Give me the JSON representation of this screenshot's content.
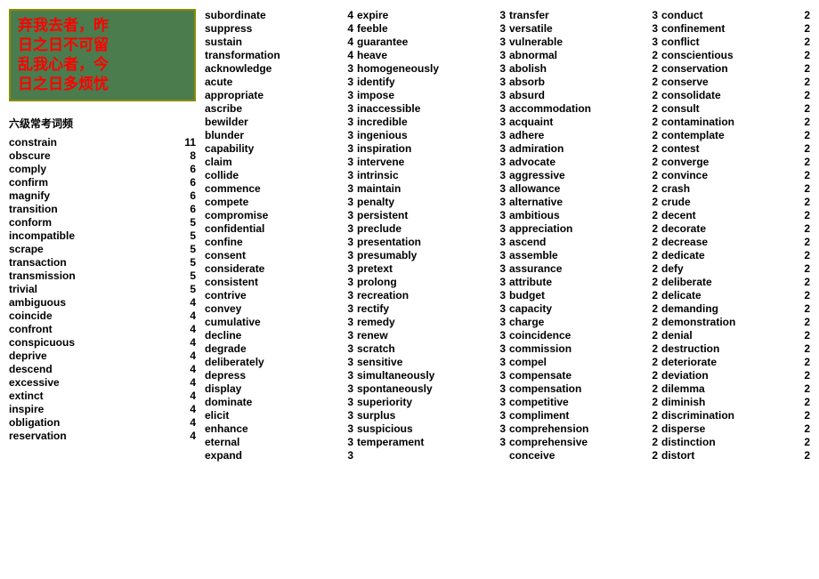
{
  "logo": {
    "lines": [
      "弃我去者，昨",
      "日之日不可留",
      "乱我心者，今",
      "日之日多烦忧"
    ]
  },
  "sectionTitle": "六级常考词频",
  "leftWords": [
    {
      "word": "constrain",
      "count": "11"
    },
    {
      "word": "obscure",
      "count": "8"
    },
    {
      "word": "comply",
      "count": "6"
    },
    {
      "word": "confirm",
      "count": "6"
    },
    {
      "word": "magnify",
      "count": "6"
    },
    {
      "word": "transition",
      "count": "6"
    },
    {
      "word": "conform",
      "count": "5"
    },
    {
      "word": "incompatible",
      "count": "5"
    },
    {
      "word": "scrape",
      "count": "5"
    },
    {
      "word": "transaction",
      "count": "5"
    },
    {
      "word": "transmission",
      "count": "5"
    },
    {
      "word": "trivial",
      "count": "5"
    },
    {
      "word": "ambiguous",
      "count": "4"
    },
    {
      "word": "coincide",
      "count": "4"
    },
    {
      "word": "confront",
      "count": "4"
    },
    {
      "word": "conspicuous",
      "count": "4"
    },
    {
      "word": "deprive",
      "count": "4"
    },
    {
      "word": "descend",
      "count": "4"
    },
    {
      "word": "excessive",
      "count": "4"
    },
    {
      "word": "extinct",
      "count": "4"
    },
    {
      "word": "inspire",
      "count": "4"
    },
    {
      "word": "obligation",
      "count": "4"
    },
    {
      "word": "reservation",
      "count": "4"
    }
  ],
  "col1": [
    {
      "word": "subordinate",
      "count": "4"
    },
    {
      "word": "suppress",
      "count": "4"
    },
    {
      "word": "sustain",
      "count": "4"
    },
    {
      "word": "transformation",
      "count": "4"
    },
    {
      "word": "acknowledge",
      "count": "3"
    },
    {
      "word": "acute",
      "count": "3"
    },
    {
      "word": "appropriate",
      "count": "3"
    },
    {
      "word": "ascribe",
      "count": "3"
    },
    {
      "word": "bewilder",
      "count": "3"
    },
    {
      "word": "blunder",
      "count": "3"
    },
    {
      "word": "capability",
      "count": "3"
    },
    {
      "word": "claim",
      "count": "3"
    },
    {
      "word": "collide",
      "count": "3"
    },
    {
      "word": "commence",
      "count": "3"
    },
    {
      "word": "compete",
      "count": "3"
    },
    {
      "word": "compromise",
      "count": "3"
    },
    {
      "word": "confidential",
      "count": "3"
    },
    {
      "word": "confine",
      "count": "3"
    },
    {
      "word": "consent",
      "count": "3"
    },
    {
      "word": "considerate",
      "count": "3"
    },
    {
      "word": "consistent",
      "count": "3"
    },
    {
      "word": "contrive",
      "count": "3"
    },
    {
      "word": "convey",
      "count": "3"
    },
    {
      "word": "cumulative",
      "count": "3"
    },
    {
      "word": "decline",
      "count": "3"
    },
    {
      "word": "degrade",
      "count": "3"
    },
    {
      "word": "deliberately",
      "count": "3"
    },
    {
      "word": "depress",
      "count": "3"
    },
    {
      "word": "display",
      "count": "3"
    },
    {
      "word": "dominate",
      "count": "3"
    },
    {
      "word": "elicit",
      "count": "3"
    },
    {
      "word": "enhance",
      "count": "3"
    },
    {
      "word": "eternal",
      "count": "3"
    },
    {
      "word": "expand",
      "count": "3"
    }
  ],
  "col2": [
    {
      "word": "expire",
      "count": "3"
    },
    {
      "word": "feeble",
      "count": "3"
    },
    {
      "word": "guarantee",
      "count": "3"
    },
    {
      "word": "heave",
      "count": "3"
    },
    {
      "word": "homogeneously",
      "count": "3"
    },
    {
      "word": "identify",
      "count": "3"
    },
    {
      "word": "impose",
      "count": "3"
    },
    {
      "word": "inaccessible",
      "count": "3"
    },
    {
      "word": "incredible",
      "count": "3"
    },
    {
      "word": "ingenious",
      "count": "3"
    },
    {
      "word": "inspiration",
      "count": "3"
    },
    {
      "word": "intervene",
      "count": "3"
    },
    {
      "word": "intrinsic",
      "count": "3"
    },
    {
      "word": "maintain",
      "count": "3"
    },
    {
      "word": "penalty",
      "count": "3"
    },
    {
      "word": "persistent",
      "count": "3"
    },
    {
      "word": "preclude",
      "count": "3"
    },
    {
      "word": "presentation",
      "count": "3"
    },
    {
      "word": "presumably",
      "count": "3"
    },
    {
      "word": "pretext",
      "count": "3"
    },
    {
      "word": "prolong",
      "count": "3"
    },
    {
      "word": "recreation",
      "count": "3"
    },
    {
      "word": "rectify",
      "count": "3"
    },
    {
      "word": "remedy",
      "count": "3"
    },
    {
      "word": "renew",
      "count": "3"
    },
    {
      "word": "scratch",
      "count": "3"
    },
    {
      "word": "sensitive",
      "count": "3"
    },
    {
      "word": "simultaneously",
      "count": "3"
    },
    {
      "word": "spontaneously",
      "count": "3"
    },
    {
      "word": "superiority",
      "count": "3"
    },
    {
      "word": "surplus",
      "count": "3"
    },
    {
      "word": "suspicious",
      "count": "3"
    },
    {
      "word": "temperament",
      "count": "3"
    }
  ],
  "col3": [
    {
      "word": "transfer",
      "count": "3"
    },
    {
      "word": "versatile",
      "count": "3"
    },
    {
      "word": "vulnerable",
      "count": "3"
    },
    {
      "word": "abnormal",
      "count": "2"
    },
    {
      "word": "abolish",
      "count": "2"
    },
    {
      "word": "absorb",
      "count": "2"
    },
    {
      "word": "absurd",
      "count": "2"
    },
    {
      "word": "accommodation",
      "count": "2"
    },
    {
      "word": "acquaint",
      "count": "2"
    },
    {
      "word": "adhere",
      "count": "2"
    },
    {
      "word": "admiration",
      "count": "2"
    },
    {
      "word": "advocate",
      "count": "2"
    },
    {
      "word": "aggressive",
      "count": "2"
    },
    {
      "word": "allowance",
      "count": "2"
    },
    {
      "word": "alternative",
      "count": "2"
    },
    {
      "word": "ambitious",
      "count": "2"
    },
    {
      "word": "appreciation",
      "count": "2"
    },
    {
      "word": "ascend",
      "count": "2"
    },
    {
      "word": "assemble",
      "count": "2"
    },
    {
      "word": "assurance",
      "count": "2"
    },
    {
      "word": "attribute",
      "count": "2"
    },
    {
      "word": "budget",
      "count": "2"
    },
    {
      "word": "capacity",
      "count": "2"
    },
    {
      "word": "charge",
      "count": "2"
    },
    {
      "word": "coincidence",
      "count": "2"
    },
    {
      "word": "commission",
      "count": "2"
    },
    {
      "word": "compel",
      "count": "2"
    },
    {
      "word": "compensate",
      "count": "2"
    },
    {
      "word": "compensation",
      "count": "2"
    },
    {
      "word": "competitive",
      "count": "2"
    },
    {
      "word": "compliment",
      "count": "2"
    },
    {
      "word": "comprehension",
      "count": "2"
    },
    {
      "word": "comprehensive",
      "count": "2"
    },
    {
      "word": "conceive",
      "count": "2"
    }
  ],
  "col4": [
    {
      "word": "conduct",
      "count": "2"
    },
    {
      "word": "confinement",
      "count": "2"
    },
    {
      "word": "conflict",
      "count": "2"
    },
    {
      "word": "conscientious",
      "count": "2"
    },
    {
      "word": "conservation",
      "count": "2"
    },
    {
      "word": "conserve",
      "count": "2"
    },
    {
      "word": "consolidate",
      "count": "2"
    },
    {
      "word": "consult",
      "count": "2"
    },
    {
      "word": "contamination",
      "count": "2"
    },
    {
      "word": "contemplate",
      "count": "2"
    },
    {
      "word": "contest",
      "count": "2"
    },
    {
      "word": "converge",
      "count": "2"
    },
    {
      "word": "convince",
      "count": "2"
    },
    {
      "word": "crash",
      "count": "2"
    },
    {
      "word": "crude",
      "count": "2"
    },
    {
      "word": "decent",
      "count": "2"
    },
    {
      "word": "decorate",
      "count": "2"
    },
    {
      "word": "decrease",
      "count": "2"
    },
    {
      "word": "dedicate",
      "count": "2"
    },
    {
      "word": "defy",
      "count": "2"
    },
    {
      "word": "deliberate",
      "count": "2"
    },
    {
      "word": "delicate",
      "count": "2"
    },
    {
      "word": "demanding",
      "count": "2"
    },
    {
      "word": "demonstration",
      "count": "2"
    },
    {
      "word": "denial",
      "count": "2"
    },
    {
      "word": "destruction",
      "count": "2"
    },
    {
      "word": "deteriorate",
      "count": "2"
    },
    {
      "word": "deviation",
      "count": "2"
    },
    {
      "word": "dilemma",
      "count": "2"
    },
    {
      "word": "diminish",
      "count": "2"
    },
    {
      "word": "discrimination",
      "count": "2"
    },
    {
      "word": "disperse",
      "count": "2"
    },
    {
      "word": "distinction",
      "count": "2"
    },
    {
      "word": "distort",
      "count": "2"
    }
  ]
}
